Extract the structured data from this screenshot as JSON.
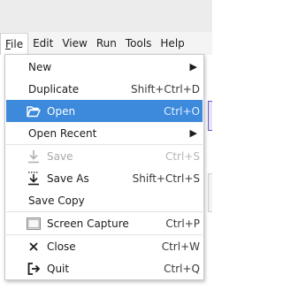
{
  "menubar": {
    "items": [
      {
        "label": "File",
        "mnemonic": "F",
        "rest": "ile"
      },
      {
        "label": "Edit"
      },
      {
        "label": "View"
      },
      {
        "label": "Run"
      },
      {
        "label": "Tools"
      },
      {
        "label": "Help"
      }
    ]
  },
  "file_menu": {
    "items": [
      {
        "label": "New",
        "submenu": true
      },
      {
        "label": "Duplicate",
        "shortcut": "Shift+Ctrl+D"
      },
      {
        "label": "Open",
        "shortcut": "Ctrl+O",
        "icon": "folder-open-icon",
        "highlighted": true
      },
      {
        "label": "Open Recent",
        "submenu": true
      },
      {
        "label": "Save",
        "shortcut": "Ctrl+S",
        "icon": "save-icon",
        "disabled": true
      },
      {
        "label": "Save As",
        "shortcut": "Shift+Ctrl+S",
        "icon": "save-as-icon"
      },
      {
        "label": "Save Copy"
      },
      {
        "label": "Screen Capture",
        "shortcut": "Ctrl+P",
        "icon": "screen-capture-icon"
      },
      {
        "label": "Close",
        "shortcut": "Ctrl+W",
        "icon": "close-icon"
      },
      {
        "label": "Quit",
        "shortcut": "Ctrl+Q",
        "icon": "quit-icon"
      }
    ]
  },
  "colors": {
    "highlight": "#3d89db",
    "disabled_text": "#a9a9a9"
  }
}
